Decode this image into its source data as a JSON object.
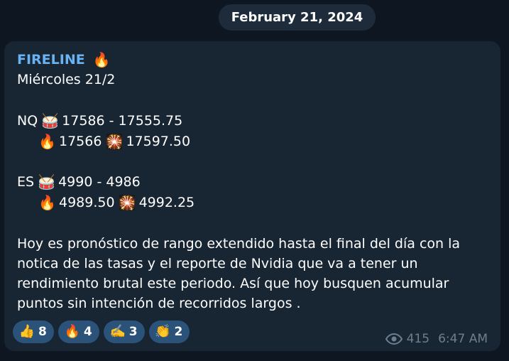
{
  "date_divider": "February 21, 2024",
  "message": {
    "sender": "FIRELINE",
    "sender_emoji": "🔥",
    "day_line": "Miércoles 21/2",
    "nq": {
      "label": "NQ",
      "icon": "drum-icon",
      "range": "17586 - 17555.75",
      "target_low": "17566",
      "target_high": "17597.50"
    },
    "es": {
      "label": "ES",
      "icon": "drum-icon",
      "range": "4990 - 4986",
      "target_low": "4989.50",
      "target_high": "4992.25"
    },
    "paragraph_lines": [
      "Hoy es pronóstico de rango extendido hasta el final del día con la",
      "notica de las tasas y el reporte de Nvidia que va a tener un",
      "rendimiento brutal este periodo. Así que hoy busquen acumular",
      "puntos sin intención de recorridos largos ."
    ],
    "reactions": [
      {
        "emoji": "👍",
        "icon": "thumbs-up-icon",
        "count": "8"
      },
      {
        "emoji": "🔥",
        "icon": "fire-icon",
        "count": "4"
      },
      {
        "emoji": "✍️",
        "icon": "writing-hand-icon",
        "count": "3"
      },
      {
        "emoji": "👏",
        "icon": "clapping-hands-icon",
        "count": "2"
      }
    ],
    "views": "415",
    "time": "6:47 AM"
  },
  "colors": {
    "background": "#0e1621",
    "bubble": "#182533",
    "sender": "#6ab3f3",
    "reaction_bg": "#2b5278",
    "meta": "#6d7f8f"
  }
}
